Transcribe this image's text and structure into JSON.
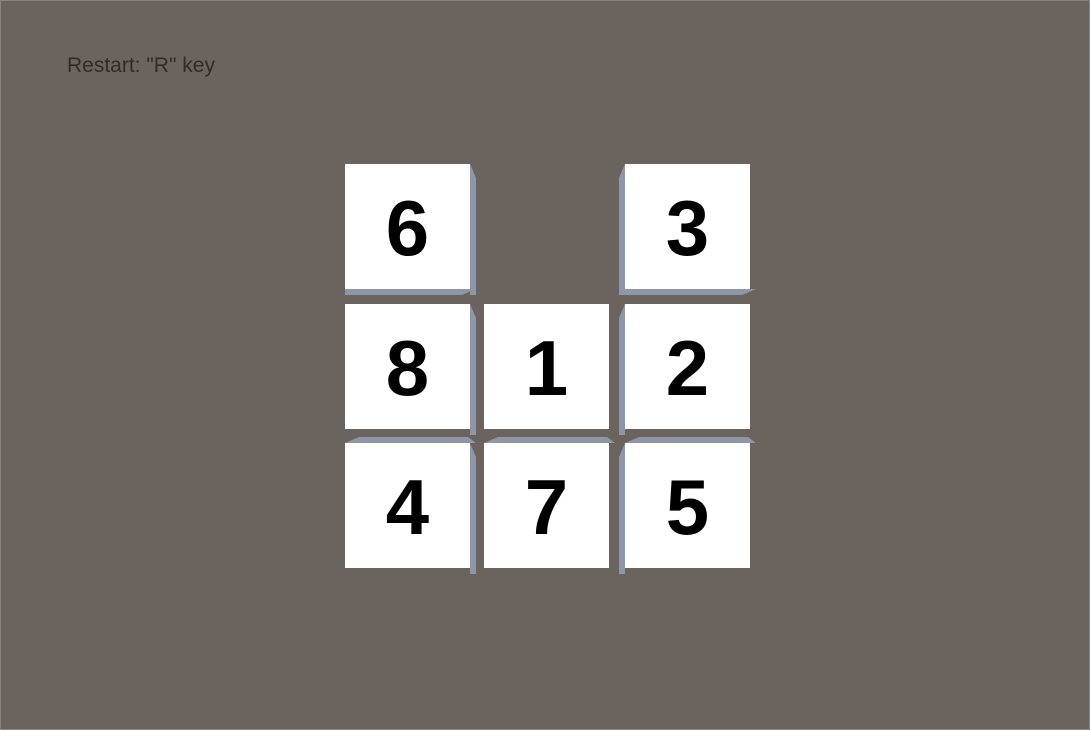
{
  "colors": {
    "background": "#6b645e",
    "hint_text": "#2f2c2a",
    "tile_face": "#ffffff",
    "tile_bevel": "#8d97a8",
    "tile_number": "#000000"
  },
  "hint": {
    "label": "Restart: \"R\" key"
  },
  "puzzle": {
    "grid_size": 3,
    "empty_cell": [
      0,
      1
    ],
    "tiles": [
      {
        "number": "6",
        "row": 0,
        "col": 0
      },
      {
        "number": "3",
        "row": 0,
        "col": 2
      },
      {
        "number": "8",
        "row": 1,
        "col": 0
      },
      {
        "number": "1",
        "row": 1,
        "col": 1
      },
      {
        "number": "2",
        "row": 1,
        "col": 2
      },
      {
        "number": "4",
        "row": 2,
        "col": 0
      },
      {
        "number": "7",
        "row": 2,
        "col": 1
      },
      {
        "number": "5",
        "row": 2,
        "col": 2
      }
    ]
  }
}
